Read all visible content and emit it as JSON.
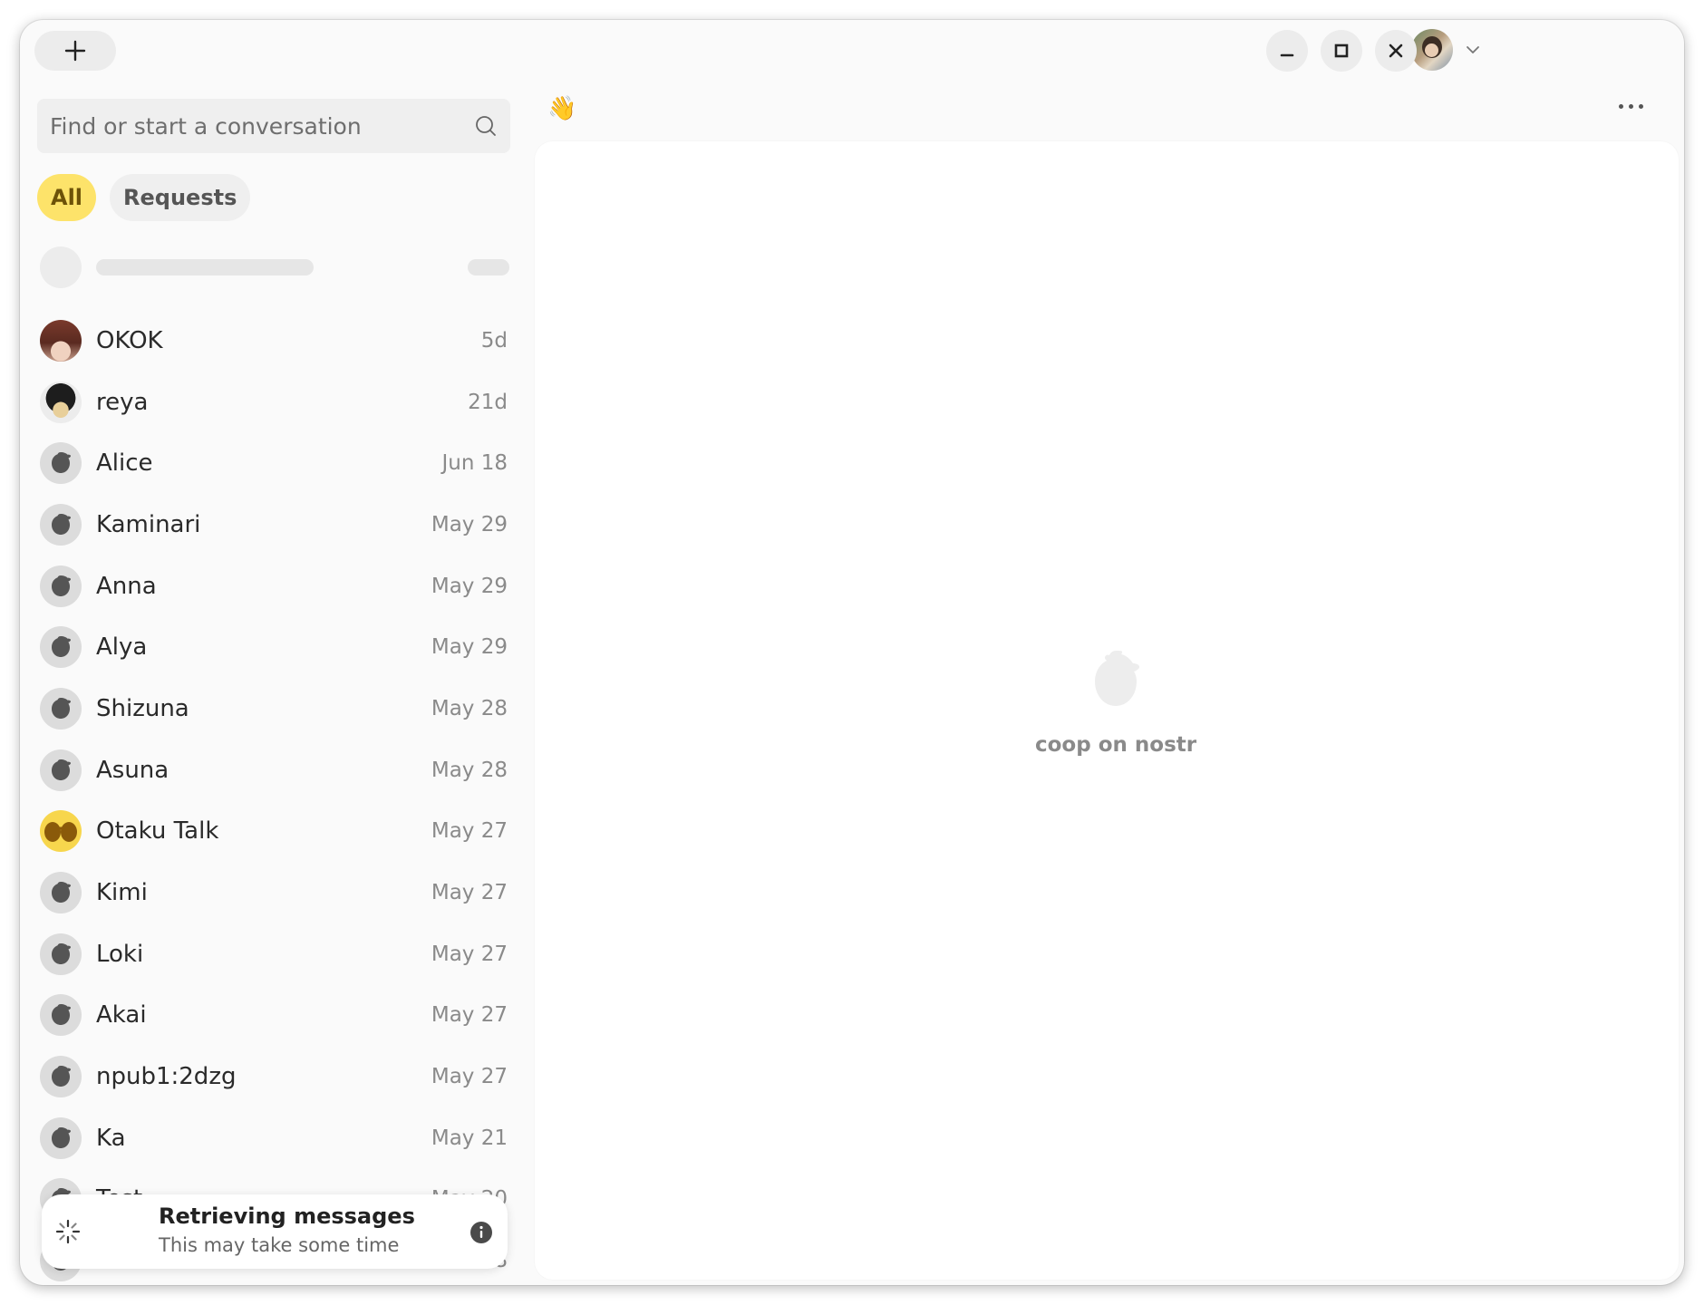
{
  "toolbar": {
    "new_icon": "plus-icon"
  },
  "window_controls": {
    "minimize_icon": "minimize-icon",
    "maximize_icon": "maximize-icon",
    "close_icon": "close-icon"
  },
  "account": {
    "avatar_icon": "user-avatar",
    "menu_icon": "chevron-down-icon"
  },
  "search": {
    "placeholder": "Find or start a conversation",
    "value": "",
    "icon": "search-icon"
  },
  "filters": [
    {
      "label": "All",
      "active": true
    },
    {
      "label": "Requests",
      "active": false
    }
  ],
  "conversations": [
    {
      "name": "OKOK",
      "time": "5d",
      "avatar": "okok"
    },
    {
      "name": "reya",
      "time": "21d",
      "avatar": "reya"
    },
    {
      "name": "Alice",
      "time": "Jun 18",
      "avatar": "default"
    },
    {
      "name": "Kaminari",
      "time": "May 29",
      "avatar": "default"
    },
    {
      "name": "Anna",
      "time": "May 29",
      "avatar": "default"
    },
    {
      "name": "Alya",
      "time": "May 29",
      "avatar": "default"
    },
    {
      "name": "Shizuna",
      "time": "May 28",
      "avatar": "default"
    },
    {
      "name": "Asuna",
      "time": "May 28",
      "avatar": "default"
    },
    {
      "name": "Otaku Talk",
      "time": "May 27",
      "avatar": "otaku"
    },
    {
      "name": "Kimi",
      "time": "May 27",
      "avatar": "default"
    },
    {
      "name": "Loki",
      "time": "May 27",
      "avatar": "default"
    },
    {
      "name": "Akai",
      "time": "May 27",
      "avatar": "default"
    },
    {
      "name": "npub1:2dzg",
      "time": "May 27",
      "avatar": "default"
    },
    {
      "name": "Ka",
      "time": "May 21",
      "avatar": "default"
    },
    {
      "name": "Test",
      "time": "May 20",
      "avatar": "default"
    },
    {
      "name": "",
      "time": "…8",
      "avatar": "default"
    }
  ],
  "toast": {
    "title": "Retrieving messages",
    "subtitle": "This may take some time",
    "icon": "spinner-icon",
    "info_icon": "info-icon"
  },
  "main": {
    "header_emoji": "👋",
    "menu_icon": "more-icon",
    "empty_icon": "coop-logo-icon",
    "empty_caption": "coop on nostr"
  },
  "colors": {
    "accent": "#fde36a",
    "accent_text": "#6d5208",
    "background": "#fafafa",
    "panel": "#ffffff"
  }
}
